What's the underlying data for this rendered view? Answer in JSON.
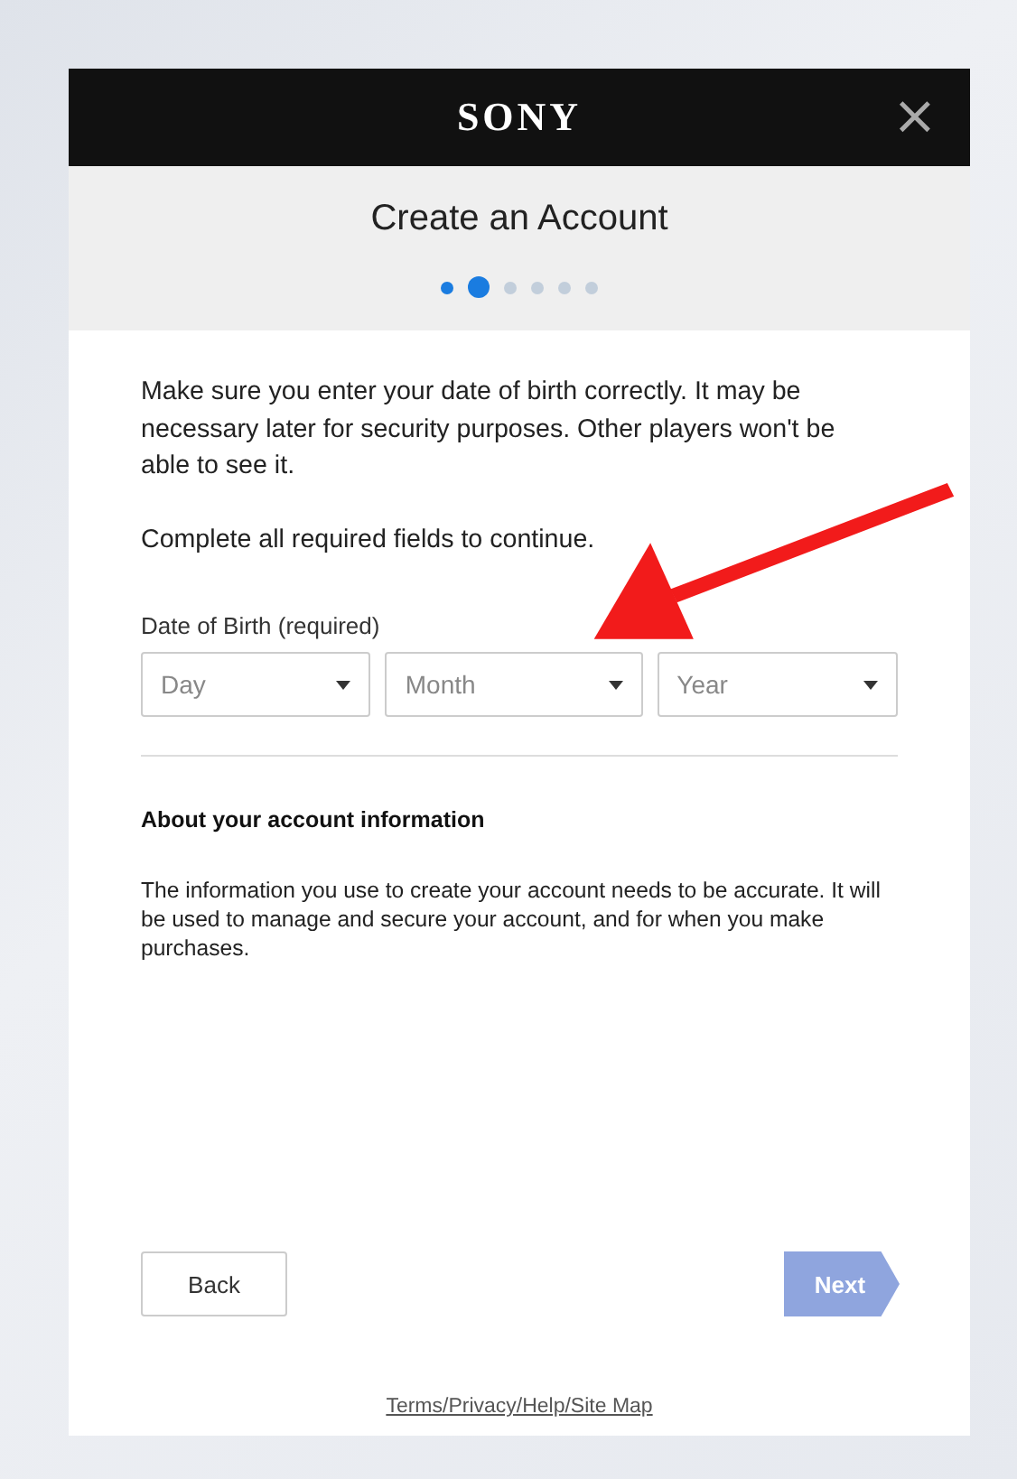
{
  "header": {
    "logo": "SONY",
    "close": "×"
  },
  "title": "Create an Account",
  "steps": [
    {
      "selected": false,
      "done": true
    },
    {
      "selected": true,
      "done": false
    },
    {
      "selected": false,
      "done": false
    },
    {
      "selected": false,
      "done": false
    },
    {
      "selected": false,
      "done": false
    },
    {
      "selected": false,
      "done": false
    }
  ],
  "intro": "Make sure you enter your date of birth correctly. It may be necessary later for security purposes. Other players won't be able to see it.",
  "required_note": "Complete all required fields to continue.",
  "dob": {
    "label": "Date of Birth (required)",
    "fields": [
      {
        "placeholder": "Day"
      },
      {
        "placeholder": "Month"
      },
      {
        "placeholder": "Year"
      }
    ]
  },
  "about": {
    "heading": "About your account information",
    "text": "The information you use to create your account needs to be accurate. It will be used to manage and secure your account, and for when you make purchases."
  },
  "buttons": {
    "back": {
      "label": "Back",
      "disabled": false
    },
    "next": {
      "label": "Next",
      "disabled": true
    }
  },
  "footer_link": "Terms/Privacy/Help/Site Map"
}
